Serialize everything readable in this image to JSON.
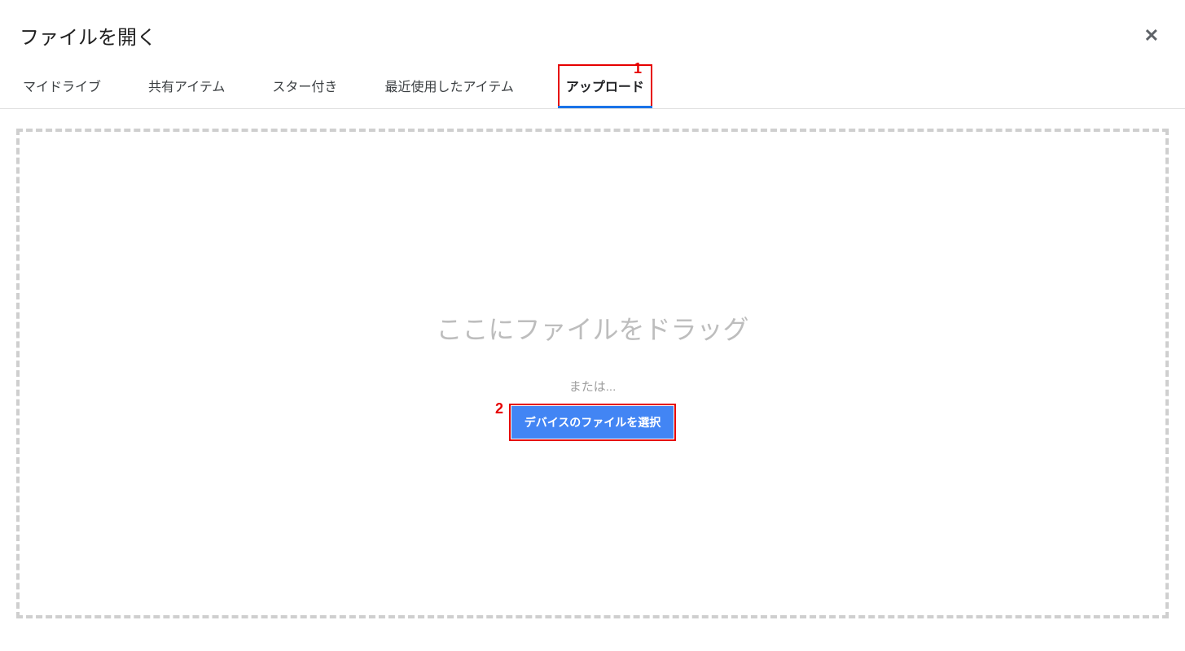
{
  "dialog": {
    "title": "ファイルを開く"
  },
  "tabs": {
    "my_drive": "マイドライブ",
    "shared": "共有アイテム",
    "starred": "スター付き",
    "recent": "最近使用したアイテム",
    "upload": "アップロード"
  },
  "dropzone": {
    "drag_text": "ここにファイルをドラッグ",
    "or_text": "または...",
    "select_button": "デバイスのファイルを選択"
  },
  "annotations": {
    "one": "1",
    "two": "2"
  }
}
